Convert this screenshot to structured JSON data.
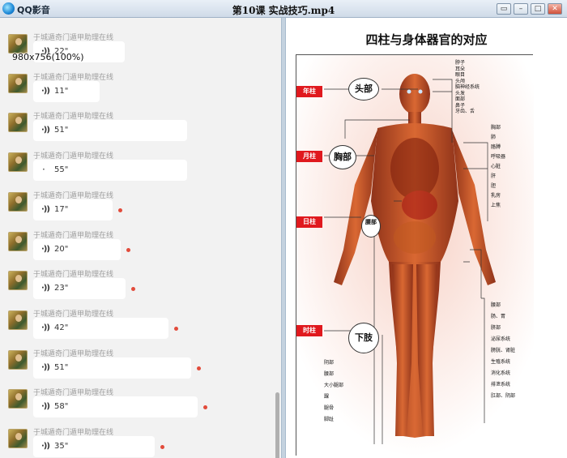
{
  "window": {
    "app_name": "QQ影音",
    "file_title": "第10课 实战技巧.mp4",
    "buttons": {
      "mini": "▭",
      "minimize": "–",
      "maximize": "□",
      "close": "✕"
    }
  },
  "chat": {
    "overlay_dimensions": "980x756(100%)",
    "messages": [
      {
        "sender": "于城遁奇门遁甲助理在线",
        "duration": "22\"",
        "unread": false
      },
      {
        "sender": "于城遁奇门遁甲助理在线",
        "duration": "11\"",
        "unread": false
      },
      {
        "sender": "于城遁奇门遁甲助理在线",
        "duration": "51\"",
        "unread": false
      },
      {
        "sender": "于城遁奇门遁甲助理在线",
        "duration": "55\"",
        "unread": false
      },
      {
        "sender": "于城遁奇门遁甲助理在线",
        "duration": "17\"",
        "unread": true
      },
      {
        "sender": "于城遁奇门遁甲助理在线",
        "duration": "20\"",
        "unread": true
      },
      {
        "sender": "于城遁奇门遁甲助理在线",
        "duration": "23\"",
        "unread": true
      },
      {
        "sender": "于城遁奇门遁甲助理在线",
        "duration": "42\"",
        "unread": true
      },
      {
        "sender": "于城遁奇门遁甲助理在线",
        "duration": "51\"",
        "unread": true
      },
      {
        "sender": "于城遁奇门遁甲助理在线",
        "duration": "58\"",
        "unread": true
      },
      {
        "sender": "于城遁奇门遁甲助理在线",
        "duration": "35\"",
        "unread": true
      }
    ]
  },
  "figure": {
    "title": "四柱与身体器官的对应",
    "pillars": [
      "年柱",
      "月柱",
      "日柱",
      "时柱"
    ],
    "regions": {
      "head": "头部",
      "chest": "胸部",
      "waist": "腰部",
      "lower": "下肢"
    },
    "head_labels": [
      "脖子",
      "耳朵",
      "眼目",
      "头颅",
      "脑神经系统",
      "头发",
      "面部",
      "鼻子",
      "牙齿、舌"
    ],
    "chest_labels": [
      "胸部",
      "肺",
      "胳膊",
      "呼吸器",
      "心脏",
      "肝",
      "胆",
      "乳房",
      "上焦"
    ],
    "waist_labels": [
      "腰部",
      "肠、胃",
      "脐部",
      "泌尿系统",
      "膀胱、肾脏",
      "生殖系统",
      "消化系统",
      "排泄系统",
      "肛部、阴部"
    ],
    "leg_labels": [
      "阴部",
      "腰部",
      "大小腿部",
      "踝",
      "腿骨",
      "脚趾"
    ],
    "colors": {
      "tag": "#e0191e",
      "body": "#b8441c"
    }
  }
}
